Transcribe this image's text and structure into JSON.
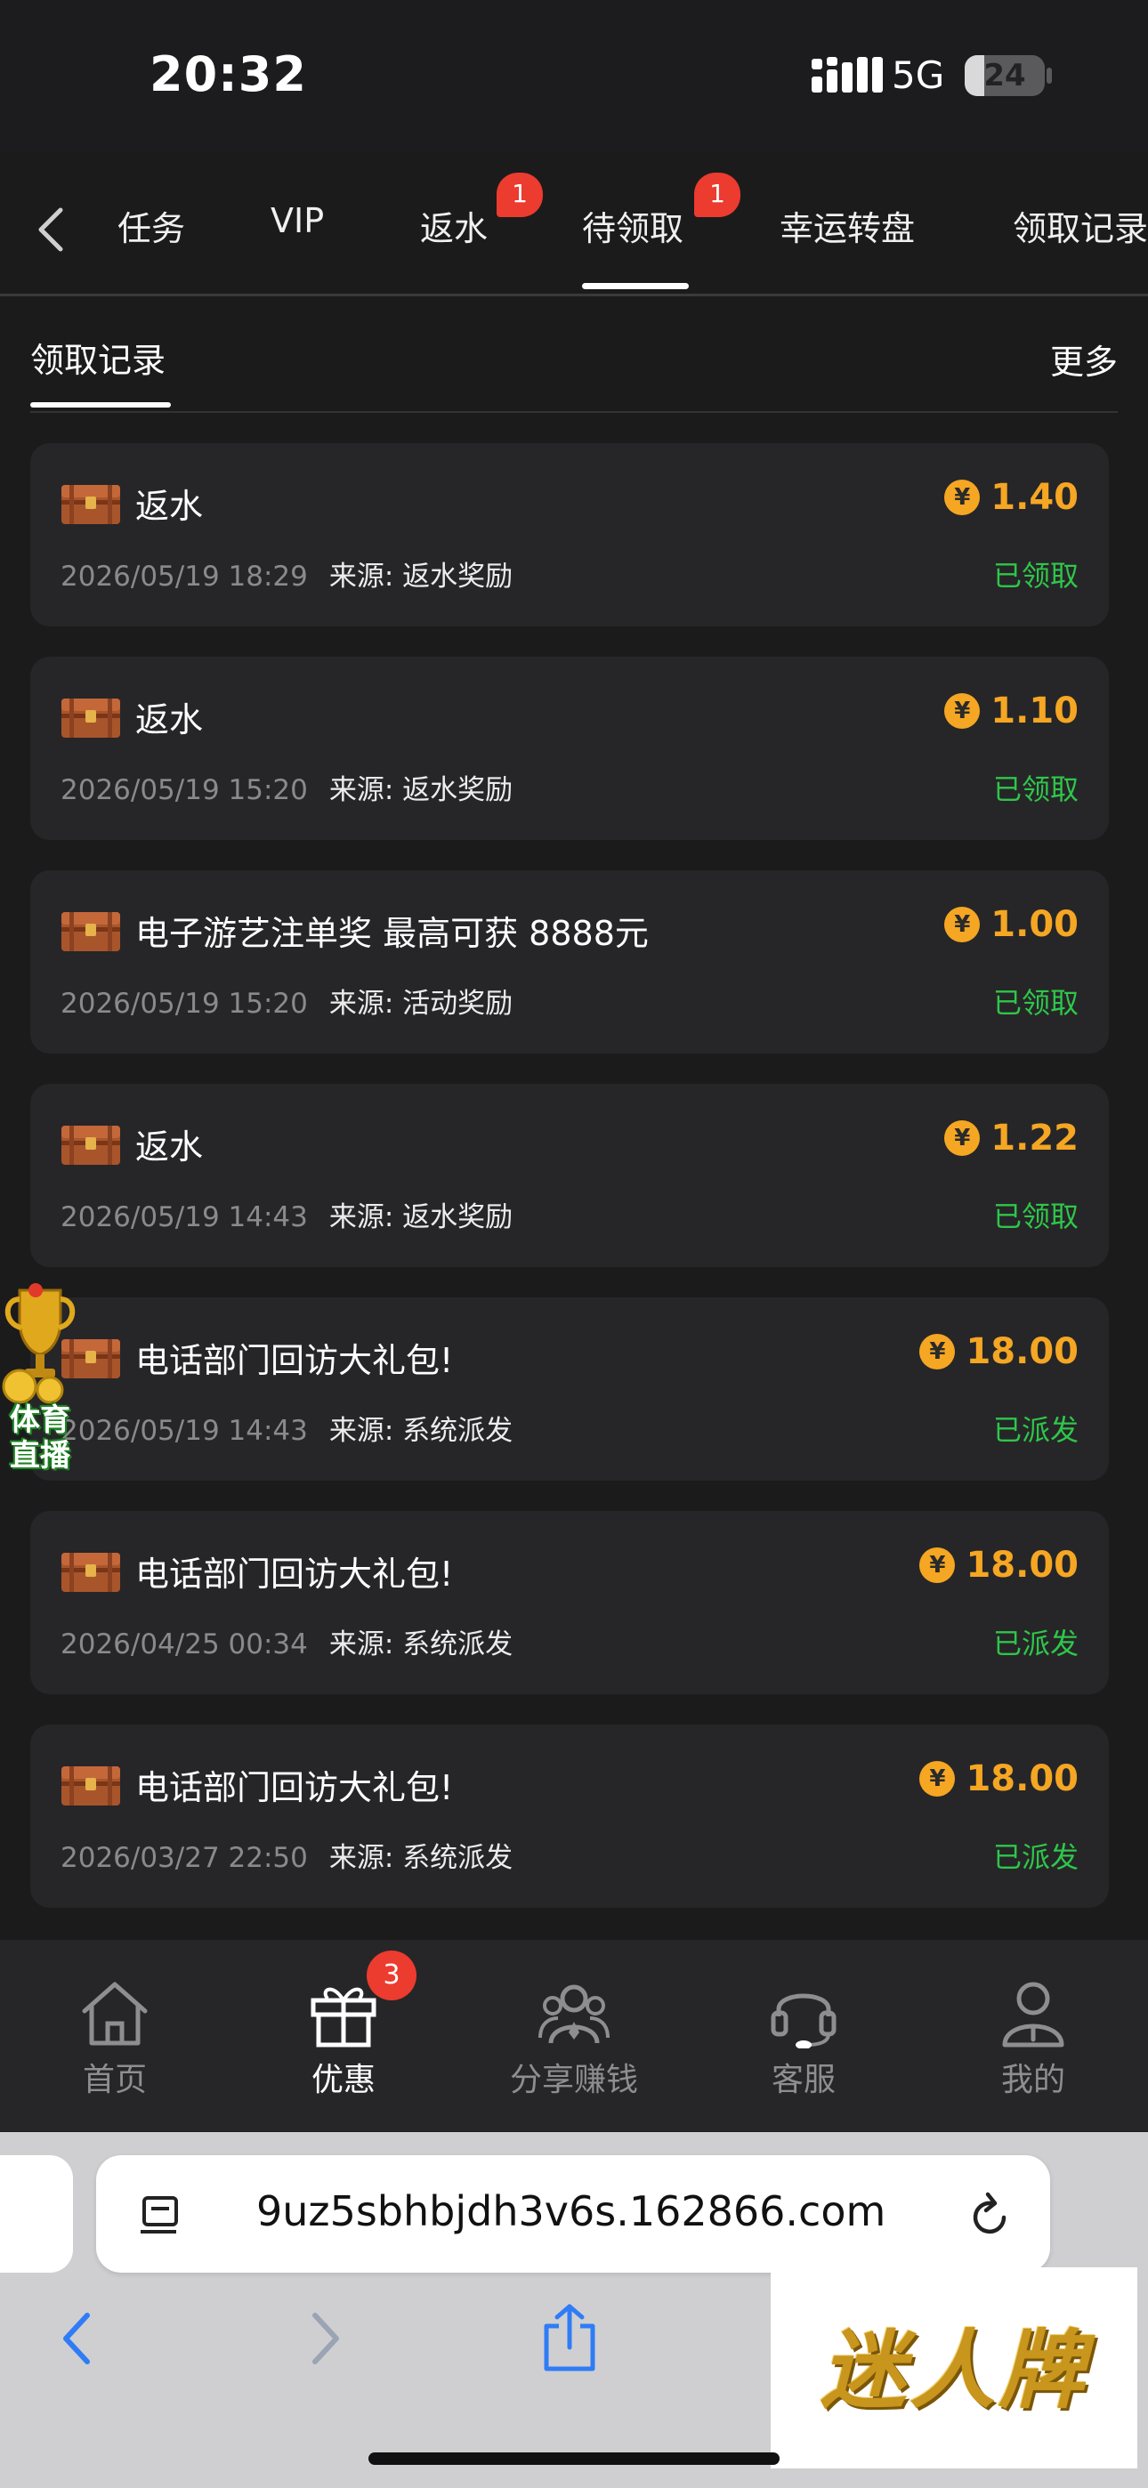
{
  "status_bar": {
    "time": "20:32",
    "network": "5G",
    "battery": "24",
    "battery_level": 0.24
  },
  "tabs": [
    {
      "label": "任务",
      "badge": ""
    },
    {
      "label": "VIP",
      "badge": ""
    },
    {
      "label": "返水",
      "badge": "1"
    },
    {
      "label": "待领取",
      "badge": "1",
      "active": true
    },
    {
      "label": "幸运转盘",
      "badge": ""
    },
    {
      "label": "领取记录",
      "badge": ""
    }
  ],
  "section": {
    "title": "领取记录",
    "more": "更多"
  },
  "records": [
    {
      "title": "返水",
      "date": "2026/05/19 18:29",
      "source": "来源: 返水奖励",
      "amount": "1.40",
      "status": "已领取"
    },
    {
      "title": "返水",
      "date": "2026/05/19 15:20",
      "source": "来源: 返水奖励",
      "amount": "1.10",
      "status": "已领取"
    },
    {
      "title": "电子游艺注单奖 最高可获 8888元",
      "date": "2026/05/19 15:20",
      "source": "来源: 活动奖励",
      "amount": "1.00",
      "status": "已领取"
    },
    {
      "title": "返水",
      "date": "2026/05/19 14:43",
      "source": "来源: 返水奖励",
      "amount": "1.22",
      "status": "已领取"
    },
    {
      "title": "电话部门回访大礼包!",
      "date": "2026/05/19 14:43",
      "source": "来源: 系统派发",
      "amount": "18.00",
      "status": "已派发"
    },
    {
      "title": "电话部门回访大礼包!",
      "date": "2026/04/25 00:34",
      "source": "来源: 系统派发",
      "amount": "18.00",
      "status": "已派发"
    },
    {
      "title": "电话部门回访大礼包!",
      "date": "2026/03/27 22:50",
      "source": "来源: 系统派发",
      "amount": "18.00",
      "status": "已派发"
    }
  ],
  "currency_symbol": "¥",
  "floating_badge": {
    "line1": "体育",
    "line2": "直播"
  },
  "bottom_nav": {
    "items": [
      {
        "label": "首页",
        "icon": "home-icon"
      },
      {
        "label": "优惠",
        "icon": "gift-icon",
        "active": true
      },
      {
        "label": "分享赚钱",
        "icon": "share-earn-icon"
      },
      {
        "label": "客服",
        "icon": "headset-icon"
      },
      {
        "label": "我的",
        "icon": "profile-icon"
      }
    ],
    "promo_badge": "3"
  },
  "browser": {
    "url": "9uz5sbhbjdh3v6s.162866.com"
  },
  "watermark": "迷人牌",
  "colors": {
    "accent_gold": "#f5a623",
    "status_green": "#2fc64a",
    "badge_red": "#ec3b2f",
    "card_bg": "#262628",
    "page_bg": "#1b1b1c"
  }
}
